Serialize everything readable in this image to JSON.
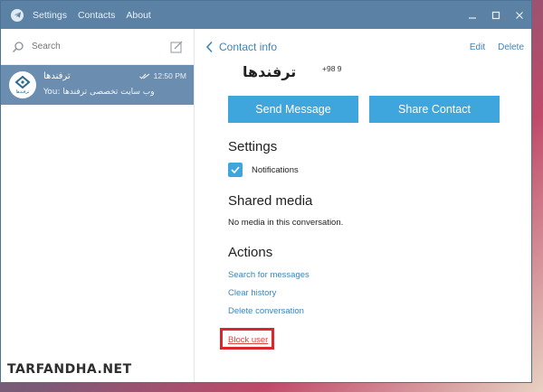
{
  "titlebar": {
    "menu": [
      "Settings",
      "Contacts",
      "About"
    ]
  },
  "sidebar": {
    "search_placeholder": "Search",
    "chat": {
      "name": "ترفندها",
      "time": "12:50 PM",
      "preview": "You: وب سایت تخصصی ترفندها",
      "avatar_label": "ترفندها"
    }
  },
  "header": {
    "title": "Contact info",
    "edit_label": "Edit",
    "delete_label": "Delete"
  },
  "profile": {
    "name": "ترفندها",
    "phone": "+98 9"
  },
  "buttons": {
    "send_message": "Send Message",
    "share_contact": "Share Contact"
  },
  "settings": {
    "title": "Settings",
    "notifications_label": "Notifications"
  },
  "shared_media": {
    "title": "Shared media",
    "empty_text": "No media in this conversation."
  },
  "actions": {
    "title": "Actions",
    "search_messages": "Search for messages",
    "clear_history": "Clear history",
    "delete_conversation": "Delete conversation",
    "block_user": "Block user"
  },
  "watermark": "TARFANDHA.NET",
  "colors": {
    "titlebar": "#5b82a4",
    "accent": "#3ea6dc",
    "link": "#3e84b8",
    "selected_chat": "#6b8db0",
    "highlight": "#d9262f"
  }
}
